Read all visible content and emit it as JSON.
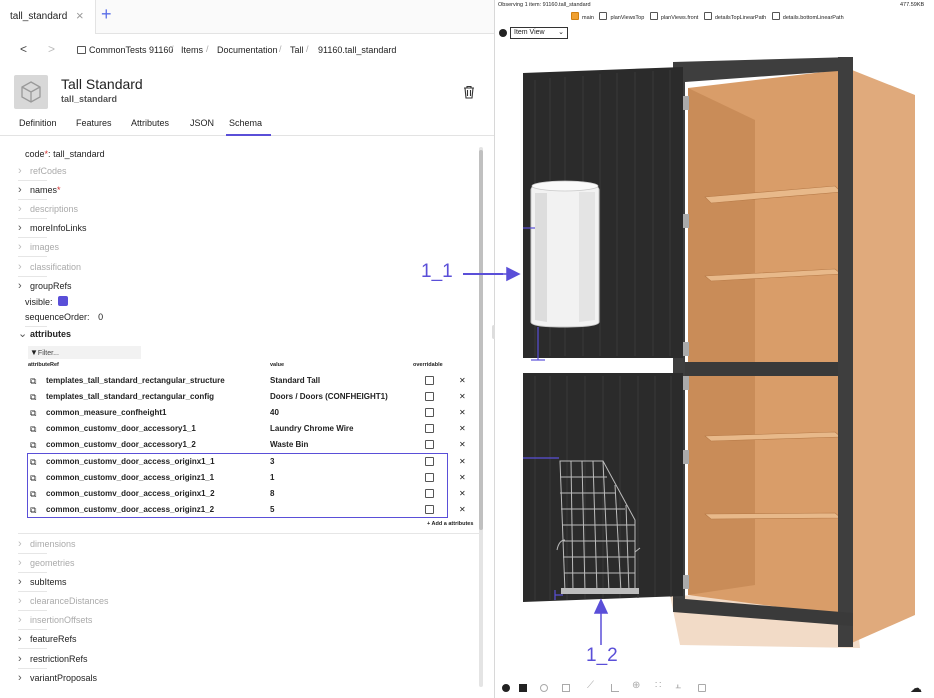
{
  "tab": {
    "title": "tall_standard",
    "close": "×",
    "add": "+"
  },
  "breadcrumb": {
    "items": [
      "CommonTests 91160",
      "Items",
      "Documentation",
      "Tall",
      "91160.tall_standard"
    ],
    "sep": "/"
  },
  "header": {
    "title": "Tall Standard",
    "code": "tall_standard"
  },
  "tabs": [
    "Definition",
    "Features",
    "Attributes",
    "JSON",
    "Schema"
  ],
  "active_tab": "Schema",
  "form": {
    "code_label": "code",
    "code_required": "*",
    "code_value": "tall_standard",
    "sections_top": [
      {
        "label": "refCodes",
        "muted": true,
        "required": false
      },
      {
        "label": "names",
        "muted": false,
        "required": true
      },
      {
        "label": "descriptions",
        "muted": true,
        "required": false
      },
      {
        "label": "moreInfoLinks",
        "muted": false,
        "required": false
      },
      {
        "label": "images",
        "muted": true,
        "required": false
      },
      {
        "label": "classification",
        "muted": true,
        "required": false
      },
      {
        "label": "groupRefs",
        "muted": false,
        "required": false
      }
    ],
    "visible_label": "visible:",
    "visible_checked": true,
    "sequence_label": "sequenceOrder:",
    "sequence_value": "0",
    "attributes_label": "attributes",
    "filter_placeholder": "Filter...",
    "col_ref": "attributeRef",
    "col_value": "value",
    "col_overridable": "overridable",
    "add_attribute": "+ Add a attributes",
    "sections_bottom": [
      {
        "label": "dimensions",
        "muted": true
      },
      {
        "label": "geometries",
        "muted": true
      },
      {
        "label": "subItems",
        "muted": false
      },
      {
        "label": "clearanceDistances",
        "muted": true
      },
      {
        "label": "insertionOffsets",
        "muted": true
      },
      {
        "label": "featureRefs",
        "muted": false
      },
      {
        "label": "restrictionRefs",
        "muted": false
      },
      {
        "label": "variantProposals",
        "muted": false
      }
    ]
  },
  "attributes": [
    {
      "ref": "templates_tall_standard_rectangular_structure",
      "value": "Standard Tall",
      "overridable": false
    },
    {
      "ref": "templates_tall_standard_rectangular_config",
      "value": "Doors / Doors (CONFHEIGHT1)",
      "overridable": false
    },
    {
      "ref": "common_measure_confheight1",
      "value": "40",
      "overridable": false
    },
    {
      "ref": "common_customv_door_accessory1_1",
      "value": "Laundry Chrome Wire",
      "overridable": false
    },
    {
      "ref": "common_customv_door_accessory1_2",
      "value": "Waste Bin",
      "overridable": false
    },
    {
      "ref": "common_customv_door_access_originx1_1",
      "value": "3",
      "overridable": false
    },
    {
      "ref": "common_customv_door_access_originz1_1",
      "value": "1",
      "overridable": false
    },
    {
      "ref": "common_customv_door_access_originx1_2",
      "value": "8",
      "overridable": false
    },
    {
      "ref": "common_customv_door_access_originz1_2",
      "value": "5",
      "overridable": false
    }
  ],
  "viewer": {
    "observing": "Observing 1 item: 91160.tall_standard",
    "size": "477.59KB",
    "layers": [
      {
        "label": "main",
        "checked": true
      },
      {
        "label": "planViewsTop",
        "checked": false
      },
      {
        "label": "planViews.front",
        "checked": false
      },
      {
        "label": "detailsTopLinearPath",
        "checked": false
      },
      {
        "label": "details.bottomLinearPath",
        "checked": false
      }
    ],
    "view_select": "Item View",
    "annotation_1": "1_1",
    "annotation_2": "1_2",
    "toolbar_icons": [
      "camera-icon",
      "grid-icon",
      "compass-icon",
      "cube-icon",
      "measure-icon",
      "frame-icon",
      "move-icon",
      "dots-icon",
      "chart-icon",
      "copy-icon"
    ],
    "download_icon": "cloud-download-icon"
  },
  "colors": {
    "accent": "#5a4fd8",
    "annotation": "#5a4fd8",
    "wood": "#e2b48a",
    "frame": "#3a3a3a",
    "door": "#2a2a2a"
  }
}
